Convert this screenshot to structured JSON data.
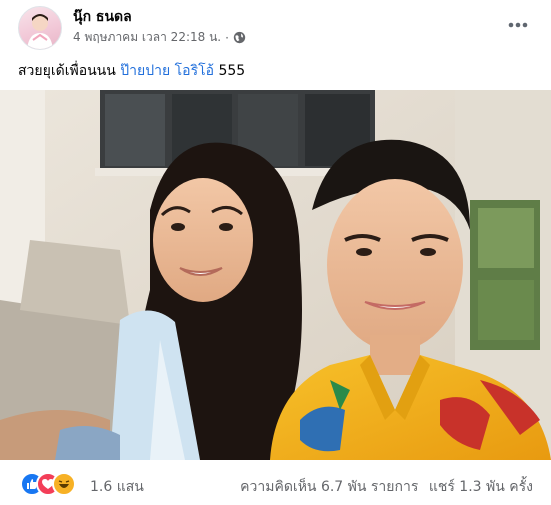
{
  "post": {
    "author": "นุ๊ก ธนดล",
    "timestamp": "4 พฤษภาคม เวลา 22:18 น.",
    "separator": "·",
    "privacy_icon": "globe-icon",
    "more_icon": "more-dots-icon",
    "caption": {
      "text": "สวยยุเด้เพื่อนนน",
      "tags": [
        "ป๊ายปาย",
        "โอริโอ้"
      ],
      "suffix": "555"
    },
    "photo_icon": "photo-two-people"
  },
  "footer": {
    "reactions": [
      "like-icon",
      "love-icon",
      "haha-icon"
    ],
    "reaction_count": "1.6 แสน",
    "comments": "ความคิดเห็น 6.7 พัน รายการ",
    "shares": "แชร์ 1.3 พัน ครั้ง"
  },
  "colors": {
    "link": "#216fdb",
    "secondary_text": "#65676b",
    "like": "#1877f2",
    "love": "#f33e58",
    "haha": "#f7b125"
  }
}
